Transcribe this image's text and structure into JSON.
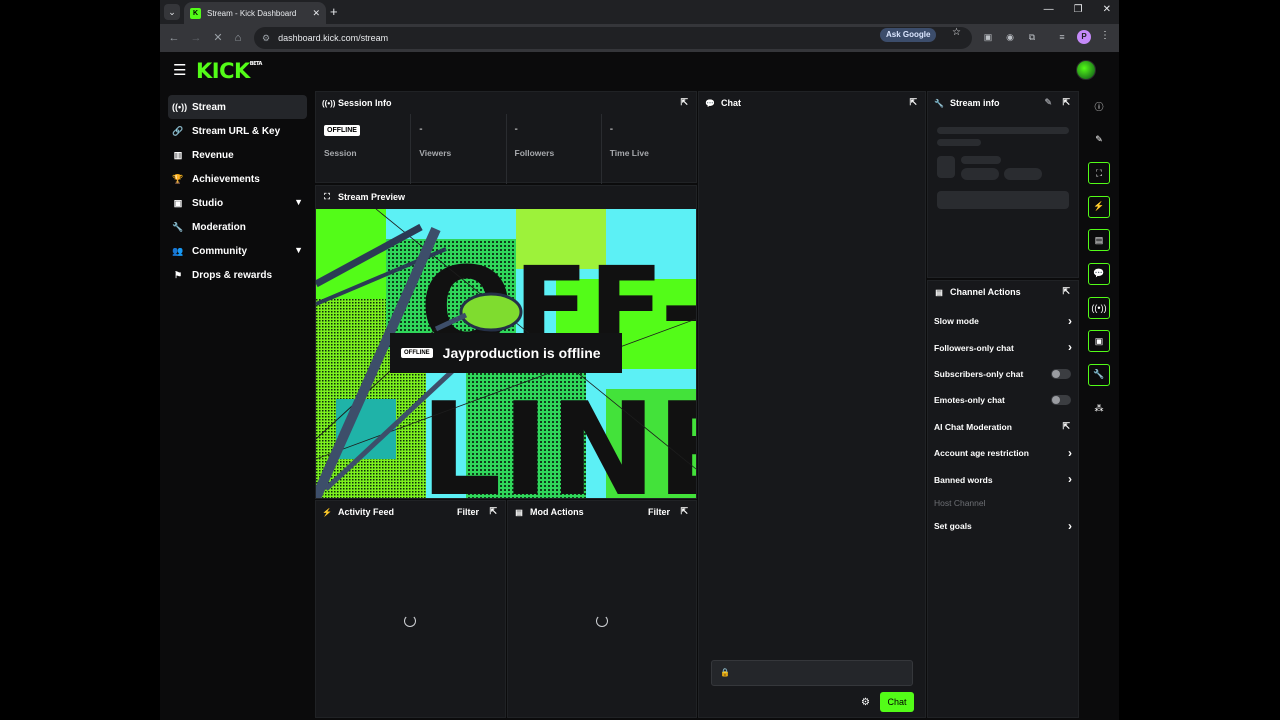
{
  "browser": {
    "tab_title": "Stream - Kick Dashboard",
    "tab_favicon": "K",
    "url": "dashboard.kick.com/stream",
    "ask_google": "Ask Google",
    "profile_initial": "P"
  },
  "header": {
    "logo": "KICK",
    "logo_badge": "BETA"
  },
  "sidebar": {
    "items": [
      {
        "label": "Stream",
        "icon": "broadcast-icon"
      },
      {
        "label": "Stream URL & Key",
        "icon": "link-icon"
      },
      {
        "label": "Revenue",
        "icon": "chart-icon"
      },
      {
        "label": "Achievements",
        "icon": "trophy-icon"
      },
      {
        "label": "Studio",
        "icon": "studio-icon"
      },
      {
        "label": "Moderation",
        "icon": "wrench-icon"
      },
      {
        "label": "Community",
        "icon": "community-icon"
      },
      {
        "label": "Drops & rewards",
        "icon": "drops-icon"
      }
    ]
  },
  "session_info": {
    "title": "Session Info",
    "badge": "OFFLINE",
    "session_label": "Session",
    "viewers_value": "-",
    "viewers_label": "Viewers",
    "followers_value": "-",
    "followers_label": "Followers",
    "time_value": "-",
    "time_label": "Time Live"
  },
  "preview": {
    "title": "Stream Preview",
    "badge": "OFFLINE",
    "status_text": "Jayproduction is offline",
    "art_text_top": "OFF-",
    "art_text_bottom": "LINE"
  },
  "activity_feed": {
    "title": "Activity Feed",
    "filter": "Filter"
  },
  "mod_actions": {
    "title": "Mod Actions",
    "filter": "Filter"
  },
  "chat": {
    "title": "Chat",
    "send_label": "Chat"
  },
  "stream_info": {
    "title": "Stream info"
  },
  "channel_actions": {
    "title": "Channel Actions",
    "slow_mode": "Slow mode",
    "followers_only": "Followers-only chat",
    "subscribers_only": "Subscribers-only chat",
    "emotes_only": "Emotes-only chat",
    "ai_moderation": "AI Chat Moderation",
    "account_age": "Account age restriction",
    "banned_words": "Banned words",
    "host_channel": "Host Channel",
    "set_goals": "Set goals"
  },
  "colors": {
    "accent": "#53fc18",
    "panel": "#17181b",
    "background": "#0b0b0c"
  }
}
